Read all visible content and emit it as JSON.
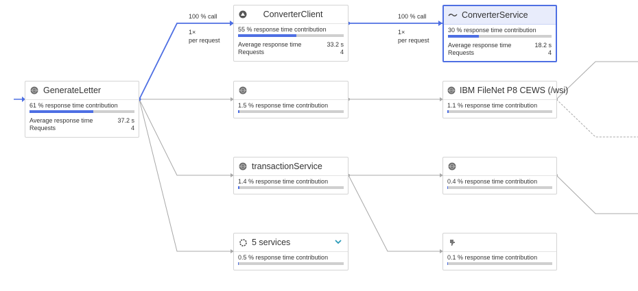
{
  "nodes": {
    "generate_letter": {
      "name": "GenerateLetter",
      "contribution": "61 % response time contribution",
      "contribution_fraction": 0.61,
      "avg_label": "Average response time",
      "avg_value": "37.2 s",
      "req_label": "Requests",
      "req_value": "4"
    },
    "converter_client": {
      "name": "ConverterClient",
      "contribution": "55 % response time contribution",
      "contribution_fraction": 0.55,
      "avg_label": "Average response time",
      "avg_value": "33.2 s",
      "req_label": "Requests",
      "req_value": "4"
    },
    "converter_service": {
      "name": "ConverterService",
      "contribution": "30 % response time contribution",
      "contribution_fraction": 0.3,
      "avg_label": "Average response time",
      "avg_value": "18.2 s",
      "req_label": "Requests",
      "req_value": "4"
    },
    "unnamed_1": {
      "contribution": "1.5 % response time contribution",
      "contribution_fraction": 0.015
    },
    "ibm_filenet": {
      "name": "IBM FileNet P8 CEWS (/wsi)",
      "contribution": "1.1 % response time contribution",
      "contribution_fraction": 0.011
    },
    "transaction_service": {
      "name": "transactionService",
      "contribution": "1.4 % response time contribution",
      "contribution_fraction": 0.014
    },
    "unnamed_2": {
      "contribution": "0.4 % response time contribution",
      "contribution_fraction": 0.004
    },
    "five_services": {
      "name": "5 services",
      "contribution": "0.5 % response time contribution",
      "contribution_fraction": 0.005
    },
    "unnamed_3": {
      "contribution": "0.1 % response time contribution",
      "contribution_fraction": 0.001
    }
  },
  "edge_labels": {
    "gl_to_cc": {
      "call": "100 % call",
      "count": "1×",
      "per": "per request"
    },
    "cc_to_cs": {
      "call": "100 % call",
      "count": "1×",
      "per": "per request"
    }
  },
  "colors": {
    "accent": "#4e6fe3",
    "edge_gray": "#a8a8a8",
    "bar_track": "#cfcfcf",
    "selected_header": "#e8ecfb"
  },
  "icons": {
    "service": "globe-icon",
    "client": "client-icon",
    "converter_service": "wave-icon",
    "group": "services-group-icon",
    "expand": "chevron-down-icon",
    "plugin": "plugin-icon"
  }
}
